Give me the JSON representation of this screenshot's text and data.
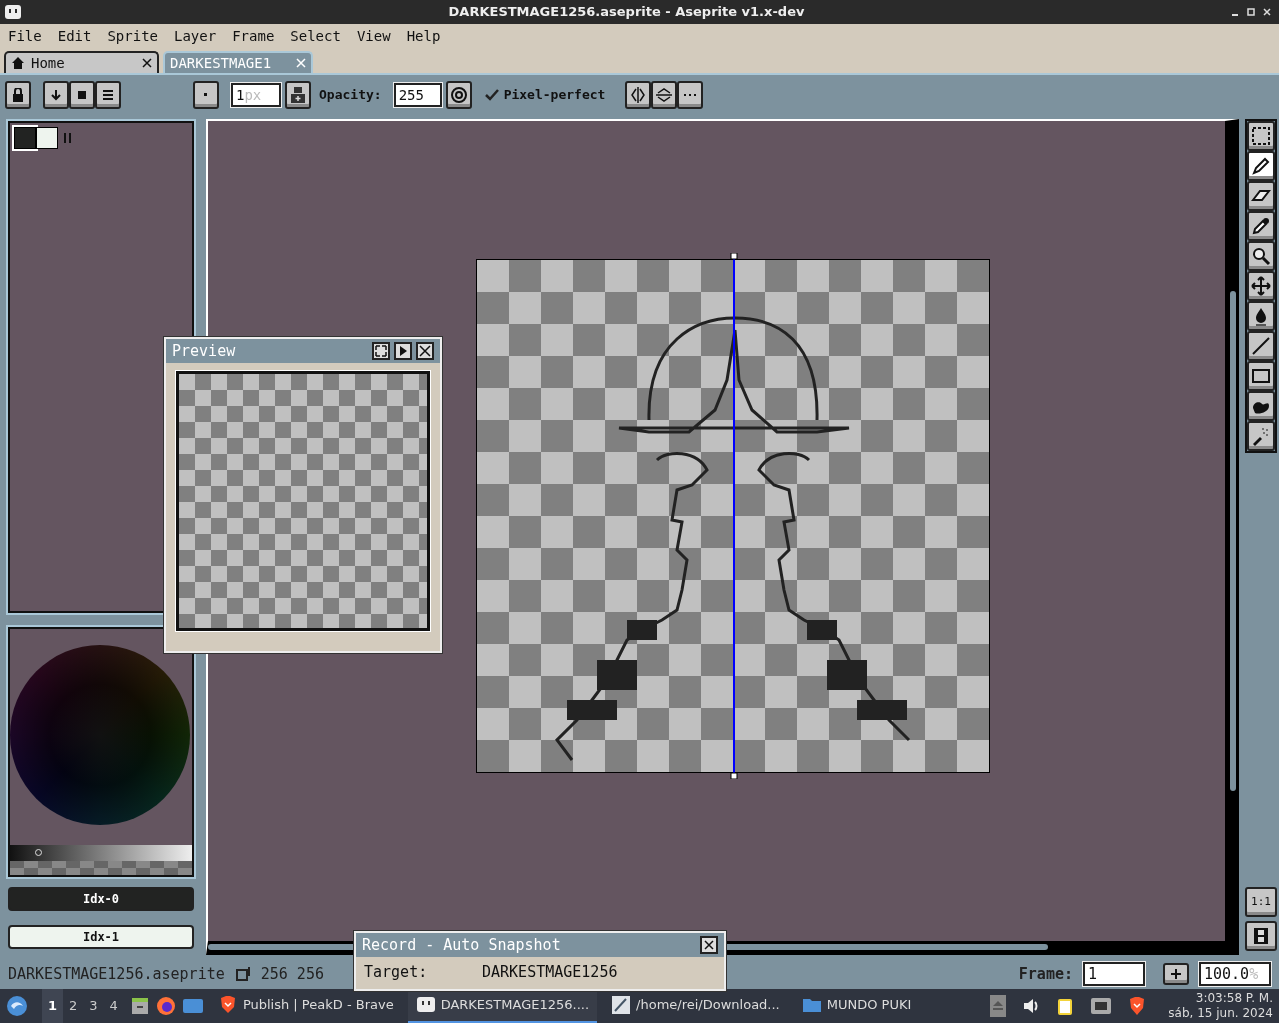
{
  "window": {
    "title": "DARKESTMAGE1256.aseprite - Aseprite v1.x-dev"
  },
  "menu": [
    "File",
    "Edit",
    "Sprite",
    "Layer",
    "Frame",
    "Select",
    "View",
    "Help"
  ],
  "tabs": [
    {
      "label": "Home",
      "kind": "home",
      "selected": false
    },
    {
      "label": "DARKESTMAGE1",
      "kind": "file",
      "selected": true
    }
  ],
  "toolbar": {
    "brush_size": "1",
    "brush_unit": "px",
    "opacity_label": "Opacity:",
    "opacity": "255",
    "pixel_perfect": {
      "label": "Pixel-perfect",
      "checked": true
    }
  },
  "tools": [
    {
      "kind": "marquee",
      "selected": false
    },
    {
      "kind": "pencil",
      "selected": true
    },
    {
      "kind": "eraser",
      "selected": false
    },
    {
      "kind": "eyedropper",
      "selected": false
    },
    {
      "kind": "zoom",
      "selected": false
    },
    {
      "kind": "move",
      "selected": false
    },
    {
      "kind": "drop",
      "selected": false
    },
    {
      "kind": "line",
      "selected": false
    },
    {
      "kind": "rectangle",
      "selected": false
    },
    {
      "kind": "blob",
      "selected": false
    },
    {
      "kind": "spray",
      "selected": false
    }
  ],
  "palette": [
    {
      "color": "#222322",
      "selected": true
    },
    {
      "color": "#eef4ee",
      "selected": false
    }
  ],
  "grayscale_slider": {
    "level": 0.14
  },
  "color_buttons": [
    {
      "label": "Idx-0",
      "color": "#222322"
    },
    {
      "label": "Idx-1",
      "color": "#eef4ee"
    }
  ],
  "zoom_reset": "1:1",
  "preview": {
    "title": "Preview"
  },
  "record": {
    "title": "Record - Auto Snapshot",
    "target_label": "Target:",
    "target": "DARKESTMAGE1256"
  },
  "status_bar": {
    "file": "DARKESTMAGE1256.aseprite",
    "size": "256 256",
    "frame_label": "Frame:",
    "frame": "1",
    "zoom": "100.0",
    "zoom_unit": "%"
  },
  "taskbar": {
    "workspaces": [
      {
        "label": "1",
        "selected": true
      },
      {
        "label": "2",
        "selected": false
      },
      {
        "label": "3",
        "selected": false
      },
      {
        "label": "4",
        "selected": false
      }
    ],
    "tasks": [
      {
        "label": "Publish | PeakD - Brave",
        "kind": "brave",
        "selected": false
      },
      {
        "label": "DARKESTMAGE1256....",
        "kind": "aseprite",
        "selected": true
      },
      {
        "label": "/home/rei/Download...",
        "kind": "editor",
        "selected": false
      },
      {
        "label": "MUNDO PUKI",
        "kind": "folder",
        "selected": false
      }
    ],
    "time": "3:03:58 P. M.",
    "date": "sáb, 15 jun. 2024"
  }
}
